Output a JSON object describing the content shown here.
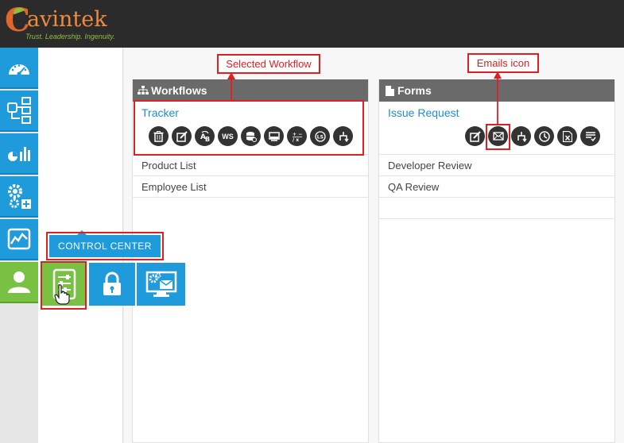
{
  "brand": {
    "logo_letter": "C",
    "logo_word": "avintek",
    "tagline": "Trust. Leadership. Ingenuity."
  },
  "nav": {
    "items": [
      {
        "icon": "dashboard-gauge-icon"
      },
      {
        "icon": "workflow-icon"
      },
      {
        "icon": "reports-chart-icon"
      },
      {
        "icon": "settings-gears-icon"
      },
      {
        "icon": "activity-monitor-icon"
      },
      {
        "icon": "user-icon",
        "active": true
      }
    ]
  },
  "tooltip": {
    "label": "CONTROL CENTER"
  },
  "subtiles": [
    {
      "icon": "control-center-sliders-icon"
    },
    {
      "icon": "lock-icon"
    },
    {
      "icon": "email-settings-monitor-icon"
    }
  ],
  "workflows": {
    "header": "Workflows",
    "selected": "Tracker",
    "actions": [
      "delete",
      "edit",
      "rename",
      "WS",
      "database",
      "display",
      "formula",
      "LS",
      "flow"
    ],
    "ws_label": "WS",
    "ls_label": "LS",
    "items": [
      "Product List",
      "Employee List"
    ]
  },
  "forms": {
    "header": "Forms",
    "selected": "Issue Request",
    "actions": [
      "edit",
      "email",
      "flow",
      "schedule",
      "excel",
      "list"
    ],
    "items": [
      "Developer Review",
      "QA Review"
    ]
  },
  "annotations": {
    "selected_workflow": "Selected Workflow",
    "emails_icon": "Emails icon"
  },
  "colors": {
    "topbar": "#2b2b2b",
    "nav_blue": "#1f9bdc",
    "nav_green": "#79c142",
    "panel_header": "#6a6a6a",
    "link_blue": "#1f8fcf",
    "annotation_red": "#e02020"
  }
}
